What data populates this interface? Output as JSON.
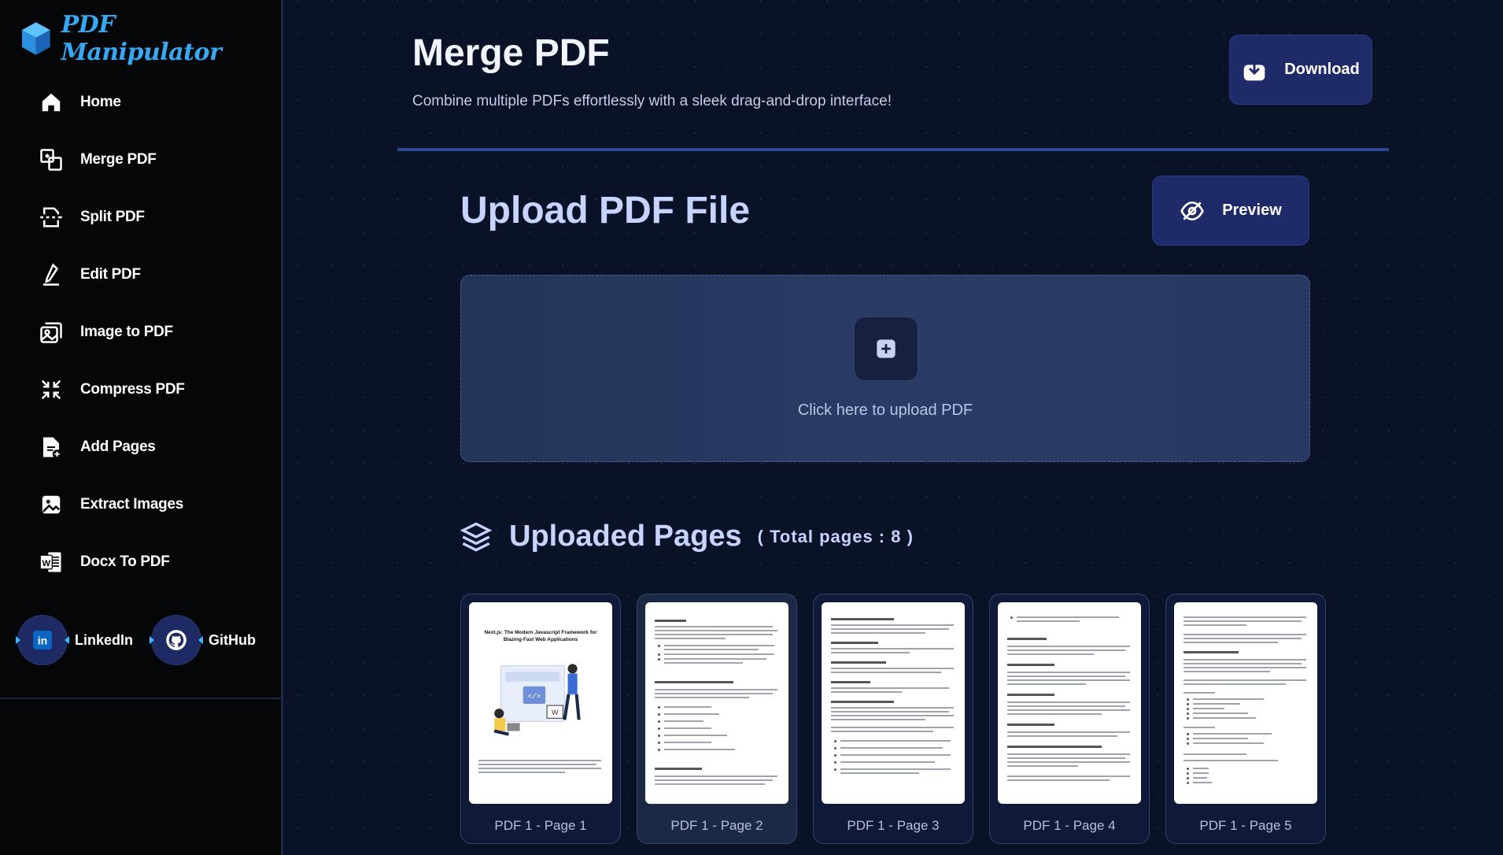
{
  "app": {
    "name": "PDF Manipulator"
  },
  "sidebar": {
    "items": [
      {
        "label": "Home",
        "icon": "home-icon"
      },
      {
        "label": "Merge PDF",
        "icon": "merge-icon"
      },
      {
        "label": "Split PDF",
        "icon": "split-icon"
      },
      {
        "label": "Edit PDF",
        "icon": "pen-icon"
      },
      {
        "label": "Image to PDF",
        "icon": "image-stack-icon"
      },
      {
        "label": "Compress PDF",
        "icon": "compress-icon"
      },
      {
        "label": "Add Pages",
        "icon": "add-file-icon"
      },
      {
        "label": "Extract Images",
        "icon": "image-icon"
      },
      {
        "label": "Docx To PDF",
        "icon": "word-icon"
      }
    ],
    "social": [
      {
        "label": "LinkedIn",
        "icon": "linkedin-icon"
      },
      {
        "label": "GitHub",
        "icon": "github-icon"
      }
    ]
  },
  "header": {
    "title": "Merge PDF",
    "subtitle": "Combine multiple PDFs effortlessly with a sleek drag-and-drop interface!",
    "download_label": "Download"
  },
  "upload": {
    "title": "Upload PDF File",
    "preview_label": "Preview",
    "prompt": "Click here to upload PDF"
  },
  "pages": {
    "title": "Uploaded Pages",
    "count_label": "( Total pages : 8 )",
    "items": [
      {
        "caption": "PDF 1 - Page 1",
        "heading": "Next.js: The Modern Javascript Framework for Blazing-Fast Web Applications"
      },
      {
        "caption": "PDF 1 - Page 2"
      },
      {
        "caption": "PDF 1 - Page 3"
      },
      {
        "caption": "PDF 1 - Page 4"
      },
      {
        "caption": "PDF 1 - Page 5"
      }
    ]
  },
  "colors": {
    "accent": "#36a9f4",
    "button": "#1f2a69",
    "sidebar": "#050608",
    "background": "#0a1228"
  }
}
